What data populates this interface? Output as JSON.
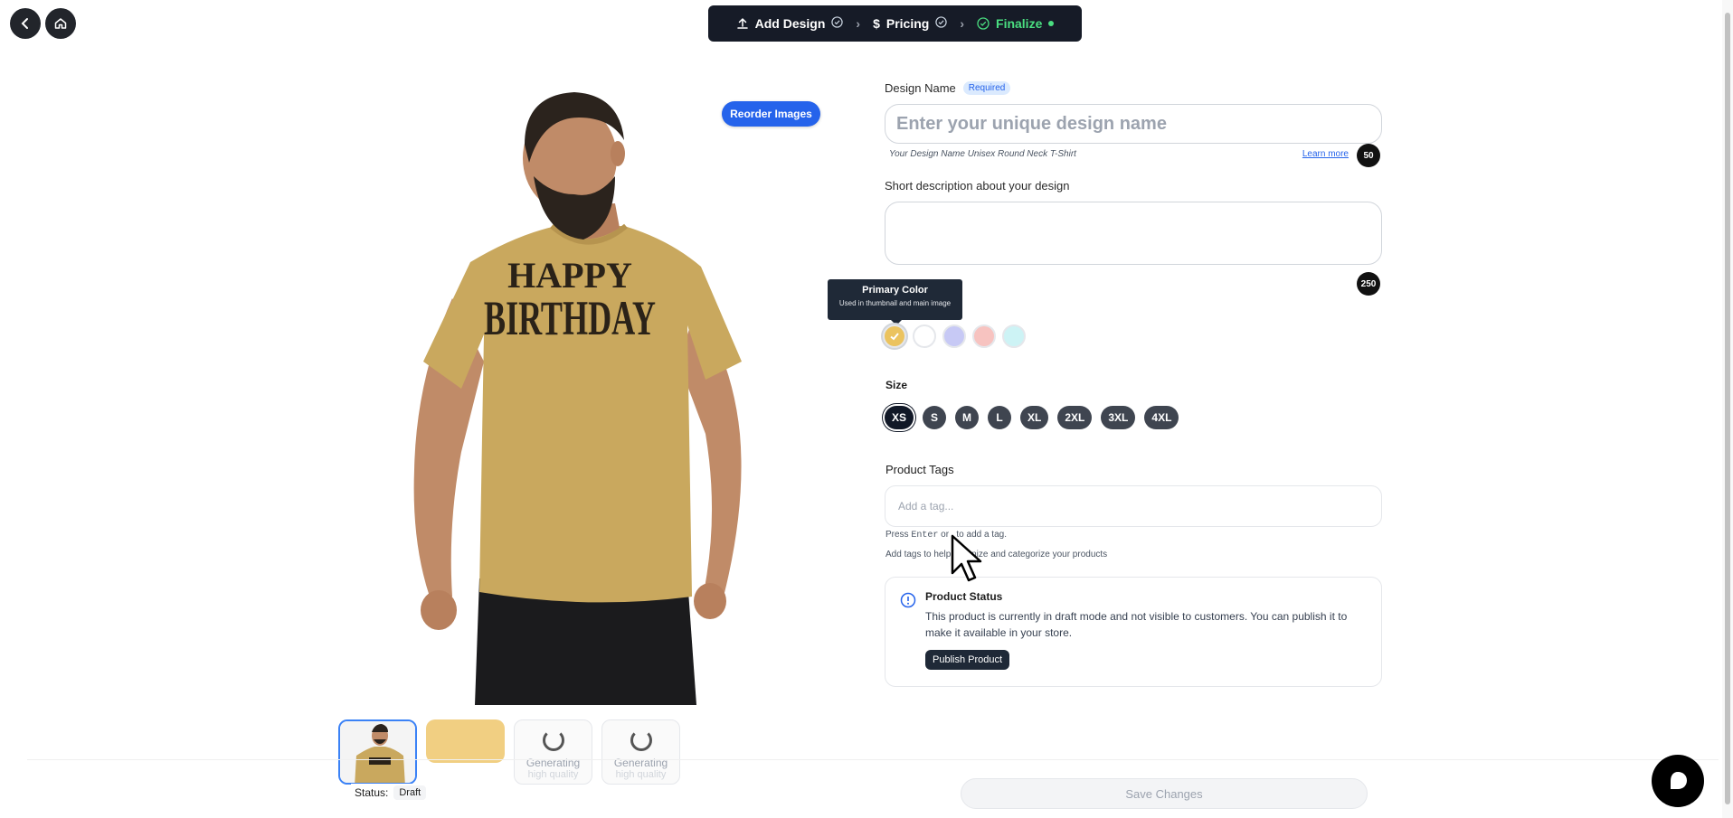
{
  "nav": {
    "back_icon": "chevron-left-icon",
    "home_icon": "home-icon"
  },
  "stepper": {
    "steps": [
      {
        "label": "Add Design",
        "icon": "upload-icon",
        "state": "done"
      },
      {
        "label": "Pricing",
        "icon": "dollar-icon",
        "state": "done"
      },
      {
        "label": "Finalize",
        "icon": "check-circle-icon",
        "state": "active"
      }
    ]
  },
  "image": {
    "reorder_label": "Reorder Images",
    "shirt_text_line1": "HAPPY",
    "shirt_text_line2": "BIRTHDAY"
  },
  "thumbnails": {
    "generating_label": "Generating",
    "generating_sub": "high quality",
    "status_label": "Status:",
    "status_value": "Draft"
  },
  "form": {
    "design_name_label": "Design Name",
    "required_badge": "Required",
    "design_name_placeholder": "Enter your unique design name",
    "design_name_hint": "Your Design Name Unisex Round Neck T-Shirt",
    "learn_more": "Learn more",
    "name_counter": "50",
    "description_label": "Short description about your design",
    "description_counter": "250",
    "tooltip_title": "Primary Color",
    "tooltip_sub": "Used in thumbnail and main image",
    "colors": [
      "#ebc35f",
      "#ffffff",
      "#c7c9f5",
      "#f7c3c0",
      "#cdf3f5"
    ],
    "size_label": "Size",
    "sizes": [
      "XS",
      "S",
      "M",
      "L",
      "XL",
      "2XL",
      "3XL",
      "4XL"
    ],
    "selected_size": "XS",
    "tags_label": "Product Tags",
    "tags_placeholder": "Add a tag...",
    "tags_help_prefix": "Press",
    "tags_help_key": "Enter",
    "tags_help_or": "or",
    "tags_help_suffix": ", to add a tag.",
    "tags_help2": "Add tags to help organize and categorize your products"
  },
  "status_card": {
    "title": "Product Status",
    "body": "This product is currently in draft mode and not visible to customers. You can publish it to make it available in your store.",
    "publish_label": "Publish Product"
  },
  "footer": {
    "save_label": "Save Changes"
  },
  "colors": {
    "accent": "#2563eb",
    "dark": "#161b27",
    "success": "#4ade80",
    "shirt": "#c9a85e"
  }
}
